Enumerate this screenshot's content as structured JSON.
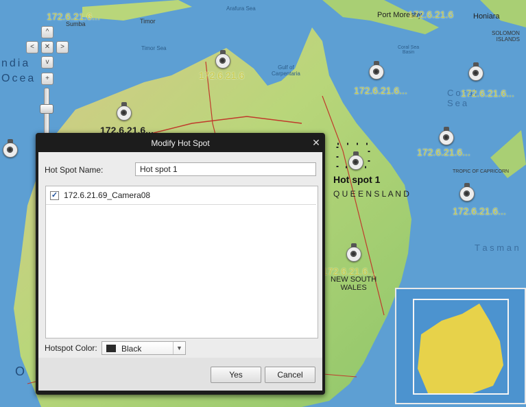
{
  "dialog": {
    "title": "Modify Hot Spot",
    "close_glyph": "✕",
    "name_label": "Hot Spot Name:",
    "name_value": "Hot spot 1",
    "cameras": [
      {
        "label": "172.6.21.69_Camera08",
        "checked": true
      }
    ],
    "color_label": "Hotspot Color:",
    "color_value": "Black",
    "color_swatch": "#2a2a2a",
    "yes_label": "Yes",
    "cancel_label": "Cancel"
  },
  "map": {
    "hotspot_name": "Hot spot 1",
    "hotspot_labels": [
      "172.6.21.6...",
      "172.6.21.6",
      "172.6.21.6",
      "172.6.21.6...",
      "172.6.21.6...",
      "172.6.21.6...",
      "172.6.21.6...",
      "172.6.21.6...",
      "172.6.21.6..."
    ],
    "place_labels": {
      "timor": "Timor",
      "sumba": "Sumba",
      "arafura": "Arafura Sea",
      "port_moresby": "Port Moresby",
      "honiara": "Honiara",
      "solomon": "SOLOMON\nISLANDS",
      "timor_sea": "Timor Sea",
      "gulf": "Gulf of\nCarpentaria",
      "coral_sea": "Coral Sea\nBasin",
      "coral_sea_big": "Coral\nSea",
      "india_ocean": "ndia\nOcea",
      "queensland": "Q U E E N S L A N D",
      "tropic": "TROPIC OF CAPRICORN",
      "tasman": "T a s m a n",
      "nsw": "NEW SOUTH\nWALES",
      "ocean_o": "O"
    }
  },
  "navigation": {
    "up": "^",
    "down": "v",
    "left": "<",
    "right": ">",
    "center": "✕",
    "zoom_in": "+"
  },
  "colors": {
    "dialog_chrome": "#1c1c1c",
    "map_water": "#5d9fd3",
    "land": "#c9d87a",
    "hotspot_label": "#c7c94a"
  }
}
